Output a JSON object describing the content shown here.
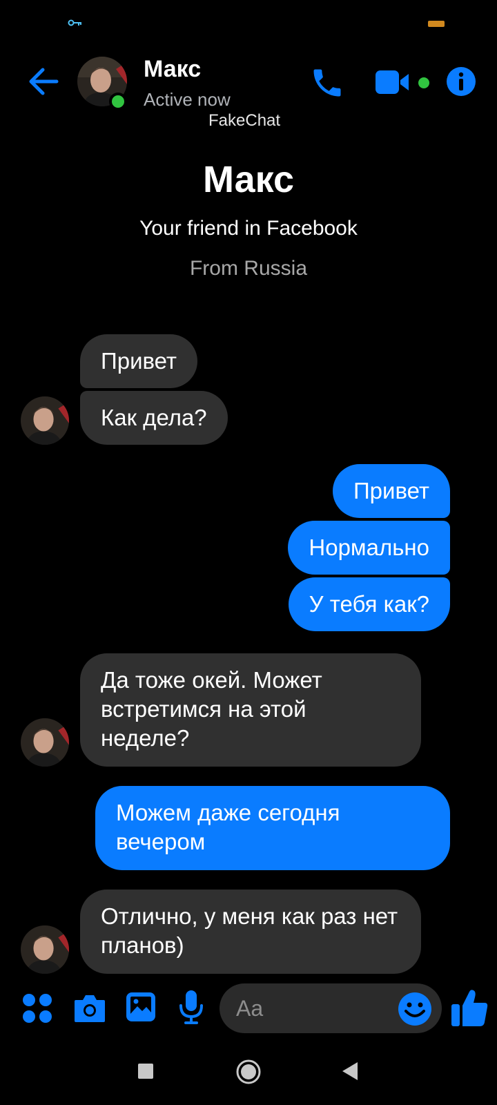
{
  "header": {
    "name": "Макс",
    "status": "Active now",
    "watermark": "FakeChat"
  },
  "profile": {
    "name": "Макс",
    "line1": "Your friend in Facebook",
    "line2": "From Russia"
  },
  "messages": [
    {
      "from": "them",
      "text": "Привет"
    },
    {
      "from": "them",
      "text": "Как дела?"
    },
    {
      "from": "me",
      "text": "Привет"
    },
    {
      "from": "me",
      "text": "Нормально"
    },
    {
      "from": "me",
      "text": "У тебя как?"
    },
    {
      "from": "them",
      "text": "Да тоже окей. Может встретимся на этой неделе?"
    },
    {
      "from": "me",
      "text": "Можем даже сегодня вечером"
    },
    {
      "from": "them",
      "text": "Отлично, у меня как раз нет планов)"
    }
  ],
  "composer": {
    "placeholder": "Aa"
  },
  "colors": {
    "accent": "#0a7cff",
    "incoming_bubble": "#303030",
    "online": "#31c440",
    "background": "#000000"
  },
  "icons": [
    "key-icon",
    "battery-icon",
    "back-arrow-icon",
    "phone-icon",
    "video-icon",
    "info-icon",
    "apps-icon",
    "camera-icon",
    "gallery-icon",
    "mic-icon",
    "emoji-icon",
    "thumbs-up-icon",
    "nav-recents-icon",
    "nav-home-icon",
    "nav-back-icon"
  ]
}
